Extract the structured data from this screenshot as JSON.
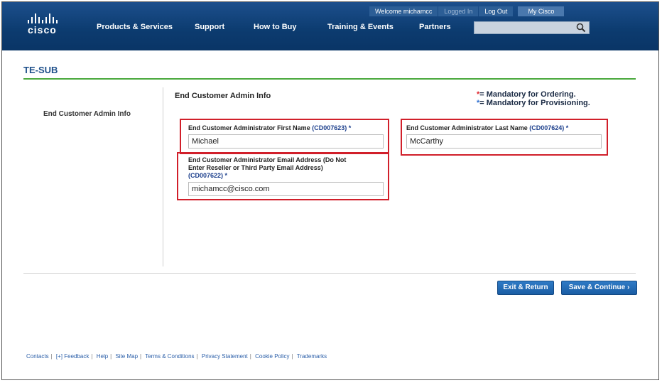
{
  "header": {
    "logo_text": "cisco",
    "utility": {
      "welcome": "Welcome michamcc",
      "logged_in": "Logged In",
      "logout": "Log Out",
      "mycisco": "My Cisco"
    },
    "nav": [
      "Products & Services",
      "Support",
      "How to Buy",
      "Training & Events",
      "Partners"
    ],
    "search_placeholder": ""
  },
  "page": {
    "title": "TE-SUB",
    "sidebar_label": "End Customer Admin Info",
    "section_title": "End Customer Admin Info",
    "legend": {
      "ordering": "= Mandatory for Ordering.",
      "provisioning": "= Mandatory for Provisioning.",
      "ordering_color": "#e0262e",
      "provisioning_color": "#2c6fd1"
    }
  },
  "fields": {
    "first_name": {
      "label": "End Customer Administrator First Name",
      "code": "(CD007623)",
      "required": "*",
      "value": "Michael"
    },
    "last_name": {
      "label": "End Customer Administrator Last Name",
      "code": "(CD007624)",
      "required": "*",
      "value": "McCarthy"
    },
    "email": {
      "label_line1": "End Customer Administrator Email Address (Do Not",
      "label_line2": "Enter Reseller or Third Party Email Address)",
      "code": "(CD007622)",
      "required": "*",
      "value": "michamcc@cisco.com"
    }
  },
  "buttons": {
    "exit": "Exit & Return",
    "save": "Save & Continue ›"
  },
  "footer": [
    "Contacts",
    "[+] Feedback",
    "Help",
    "Site Map",
    "Terms & Conditions",
    "Privacy Statement",
    "Cookie Policy",
    "Trademarks"
  ],
  "colors": {
    "header_blue": "#0c3b6f",
    "accent_green": "#4aa93d",
    "highlight_red": "#d11f2a",
    "button_blue": "#1a5da4"
  }
}
